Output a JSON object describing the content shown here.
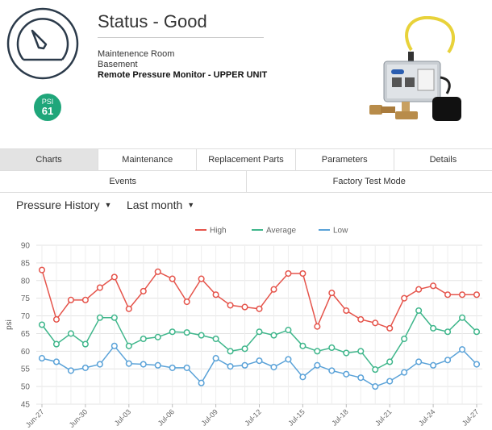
{
  "status": {
    "title": "Status - Good"
  },
  "gauge": {
    "psi_label": "PSI",
    "psi_value": "61"
  },
  "location": {
    "line1": "Maintenence Room",
    "line2": "Basement",
    "device_name": "Remote Pressure Monitor - UPPER UNIT"
  },
  "tabs_row1": [
    {
      "label": "Charts",
      "active": true
    },
    {
      "label": "Maintenance"
    },
    {
      "label": "Replacement Parts"
    },
    {
      "label": "Parameters"
    },
    {
      "label": "Details"
    }
  ],
  "tabs_row2": [
    {
      "label": "Events"
    },
    {
      "label": "Factory Test Mode"
    }
  ],
  "controls": {
    "metric_select": "Pressure History",
    "range_select": "Last month"
  },
  "chart_data": {
    "type": "line",
    "ylabel": "psi",
    "ylim": [
      45,
      90
    ],
    "yticks": [
      45,
      50,
      55,
      60,
      65,
      70,
      75,
      80,
      85,
      90
    ],
    "grid": true,
    "legend_position": "top",
    "x_tick_labels": [
      "Jun-27",
      "Jun-30",
      "Jul-03",
      "Jul-06",
      "Jul-09",
      "Jul-12",
      "Jul-15",
      "Jul-18",
      "Jul-21",
      "Jul-24",
      "Jul-27"
    ],
    "x_tick_every": 3,
    "series": [
      {
        "name": "High",
        "color": "#e5544b",
        "values": [
          83,
          69,
          74.5,
          74.5,
          78,
          81,
          72,
          77,
          82.5,
          80.5,
          74,
          80.5,
          76,
          73,
          72.5,
          72,
          77.5,
          82,
          82,
          67,
          76.5,
          71.5,
          69,
          68,
          66.5,
          75,
          77.5,
          78.5,
          76,
          76,
          76
        ]
      },
      {
        "name": "Average",
        "color": "#3fb68b",
        "values": [
          67.5,
          62,
          65,
          62,
          69.5,
          69.5,
          61.5,
          63.5,
          64,
          65.5,
          65.3,
          64.5,
          63.5,
          60,
          60.7,
          65.5,
          64.5,
          66,
          61.5,
          60,
          61,
          59.5,
          60,
          54.8,
          57,
          63.5,
          71.5,
          66.5,
          65.5,
          69.5,
          65.5
        ]
      },
      {
        "name": "Low",
        "color": "#5aa2d8",
        "values": [
          58,
          57,
          54.5,
          55.3,
          56.3,
          61.5,
          56.5,
          56.3,
          56,
          55.3,
          55.3,
          51,
          58,
          55.7,
          56,
          57.3,
          55.5,
          57.7,
          52.7,
          56,
          54.5,
          53.5,
          52.5,
          50,
          51.5,
          54,
          57,
          56,
          57.5,
          60.5,
          56.3
        ]
      }
    ]
  }
}
